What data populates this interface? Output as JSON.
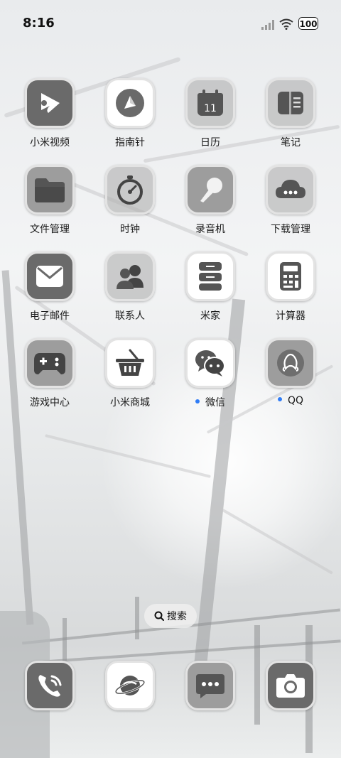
{
  "status_bar": {
    "time": "8:16",
    "battery": "100"
  },
  "apps": [
    {
      "label": "小米视频",
      "icon": "play-icon",
      "style": "dark",
      "badge": false
    },
    {
      "label": "指南针",
      "icon": "compass-icon",
      "style": "light",
      "badge": false
    },
    {
      "label": "日历",
      "icon": "calendar-icon",
      "style": "glass",
      "badge": false,
      "day": "11"
    },
    {
      "label": "笔记",
      "icon": "notes-icon",
      "style": "glass",
      "badge": false
    },
    {
      "label": "文件管理",
      "icon": "folder-icon",
      "style": "mid",
      "badge": false
    },
    {
      "label": "时钟",
      "icon": "stopwatch-icon",
      "style": "glass",
      "badge": false
    },
    {
      "label": "录音机",
      "icon": "microphone-icon",
      "style": "mid",
      "badge": false
    },
    {
      "label": "下载管理",
      "icon": "cloud-download-icon",
      "style": "glass",
      "badge": false
    },
    {
      "label": "电子邮件",
      "icon": "mail-icon",
      "style": "dark",
      "badge": false
    },
    {
      "label": "联系人",
      "icon": "contacts-icon",
      "style": "glass",
      "badge": false
    },
    {
      "label": "米家",
      "icon": "mijia-icon",
      "style": "light",
      "badge": false
    },
    {
      "label": "计算器",
      "icon": "calculator-icon",
      "style": "light",
      "badge": false
    },
    {
      "label": "游戏中心",
      "icon": "gamepad-icon",
      "style": "mid",
      "badge": false
    },
    {
      "label": "小米商城",
      "icon": "basket-icon",
      "style": "light",
      "badge": false
    },
    {
      "label": "微信",
      "icon": "wechat-icon",
      "style": "light",
      "badge": true
    },
    {
      "label": "QQ",
      "icon": "qq-icon",
      "style": "mid",
      "badge": true
    }
  ],
  "search": {
    "label": "搜索"
  },
  "dock": [
    {
      "icon": "phone-icon",
      "style": "dark"
    },
    {
      "icon": "browser-planet-icon",
      "style": "light"
    },
    {
      "icon": "messages-icon",
      "style": "mid"
    },
    {
      "icon": "camera-icon",
      "style": "dark"
    }
  ],
  "colors": {
    "badge_dot": "#2f7cf6"
  }
}
